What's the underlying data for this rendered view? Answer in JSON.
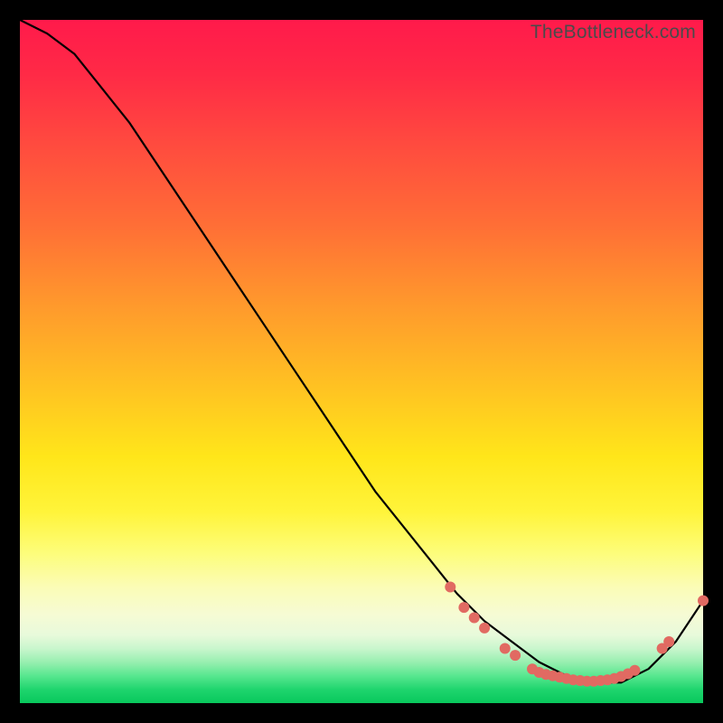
{
  "watermark": "TheBottleneck.com",
  "chart_data": {
    "type": "line",
    "title": "",
    "xlabel": "",
    "ylabel": "",
    "xlim": [
      0,
      100
    ],
    "ylim": [
      0,
      100
    ],
    "grid": false,
    "legend": false,
    "series": [
      {
        "name": "curve",
        "color": "#000000",
        "x": [
          0,
          4,
          8,
          12,
          16,
          20,
          24,
          28,
          32,
          36,
          40,
          44,
          48,
          52,
          56,
          60,
          64,
          68,
          72,
          76,
          80,
          84,
          88,
          92,
          96,
          100
        ],
        "y": [
          100,
          98,
          95,
          90,
          85,
          79,
          73,
          67,
          61,
          55,
          49,
          43,
          37,
          31,
          26,
          21,
          16,
          12,
          9,
          6,
          4,
          3,
          3,
          5,
          9,
          15
        ]
      }
    ],
    "markers": {
      "name": "highlight-points",
      "color": "#e16a62",
      "radius_px": 6,
      "points": [
        {
          "x": 63,
          "y": 17
        },
        {
          "x": 65,
          "y": 14
        },
        {
          "x": 66.5,
          "y": 12.5
        },
        {
          "x": 68,
          "y": 11
        },
        {
          "x": 71,
          "y": 8
        },
        {
          "x": 72.5,
          "y": 7
        },
        {
          "x": 75,
          "y": 5
        },
        {
          "x": 76,
          "y": 4.5
        },
        {
          "x": 77,
          "y": 4.2
        },
        {
          "x": 78,
          "y": 4
        },
        {
          "x": 79,
          "y": 3.8
        },
        {
          "x": 80,
          "y": 3.6
        },
        {
          "x": 81,
          "y": 3.4
        },
        {
          "x": 82,
          "y": 3.3
        },
        {
          "x": 83,
          "y": 3.2
        },
        {
          "x": 84,
          "y": 3.2
        },
        {
          "x": 85,
          "y": 3.3
        },
        {
          "x": 86,
          "y": 3.4
        },
        {
          "x": 87,
          "y": 3.6
        },
        {
          "x": 88,
          "y": 3.9
        },
        {
          "x": 89,
          "y": 4.3
        },
        {
          "x": 90,
          "y": 4.8
        },
        {
          "x": 94,
          "y": 8
        },
        {
          "x": 95,
          "y": 9
        },
        {
          "x": 100,
          "y": 15
        }
      ]
    }
  }
}
